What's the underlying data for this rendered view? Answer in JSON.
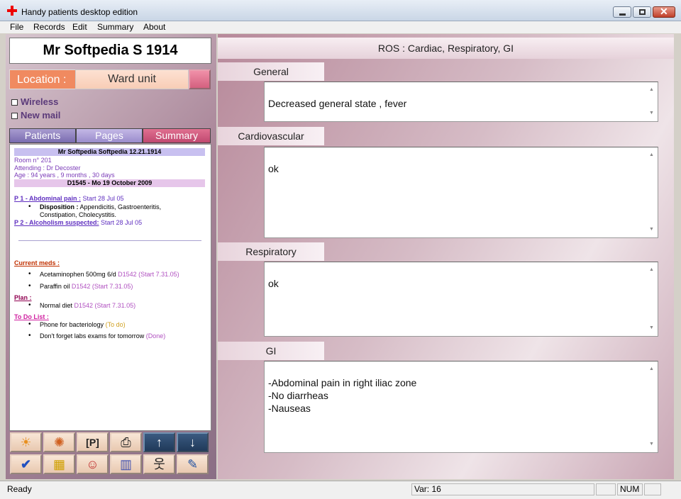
{
  "window": {
    "title": "Handy patients desktop edition"
  },
  "menu": [
    "File",
    "Records",
    "Edit",
    "Summary",
    "About"
  ],
  "left": {
    "patient_name": "Mr Softpedia S 1914",
    "location_label": "Location :",
    "location_value": "Ward unit",
    "checks": [
      "Wireless",
      "New mail"
    ],
    "tabs": [
      "Patients",
      "Pages",
      "Summary"
    ]
  },
  "summary": {
    "header": "Mr Softpedia Softpedia 12.21.1914",
    "room": "Room n° 201",
    "attending": "Attending : Dr Decoster",
    "age": "Age : 94 years , 9 months , 30 days",
    "visit": "D1545 - Mo 19 October 2009",
    "problems": [
      {
        "title": "P 1 - Abdominal pain :",
        "start": "Start 28 Jul 05",
        "disposition_label": "Disposition :",
        "disposition": "Appendicitis, Gastroenteritis,",
        "disposition2": "Constipation, Cholecystitis."
      },
      {
        "title": "P 2 - Alcoholism suspected:",
        "start": "Start 28 Jul 05"
      }
    ],
    "meds_title": "Current meds :",
    "meds": [
      {
        "name": "Acetaminophen 500mg 6/d",
        "ref": "D1542 (Start 7.31.05)"
      },
      {
        "name": "Paraffin oil",
        "ref": "D1542 (Start 7.31.05)"
      }
    ],
    "plan_title": "Plan :",
    "plan": [
      {
        "name": "Normal diet",
        "ref": "D1542 (Start 7.31.05)"
      }
    ],
    "todo_title": "To Do List :",
    "todo": [
      {
        "name": "Phone for bacteriology",
        "status": "(To do)"
      },
      {
        "name": "Don't forget labs exams for tomorrow",
        "status": "(Done)"
      }
    ]
  },
  "toolbar_icons": [
    "sun-icon",
    "sun-page-icon",
    "p-icon",
    "printer-icon",
    "arrow-up-icon",
    "arrow-down-icon",
    "checkmark-icon",
    "grid-icon",
    "person-icon",
    "chart-icon",
    "id-person-icon",
    "notepad-icon"
  ],
  "right": {
    "header": "ROS : Cardiac, Respiratory, GI",
    "sections": [
      {
        "label": "General",
        "text": "Decreased general state , fever"
      },
      {
        "label": "Cardiovascular",
        "text": "ok"
      },
      {
        "label": "Respiratory",
        "text": "ok"
      },
      {
        "label": "GI",
        "text": "-Abdominal pain in right iliac zone\n-No diarrheas\n-Nauseas"
      }
    ]
  },
  "status": {
    "ready": "Ready",
    "var": "Var: 16",
    "num": "NUM"
  }
}
